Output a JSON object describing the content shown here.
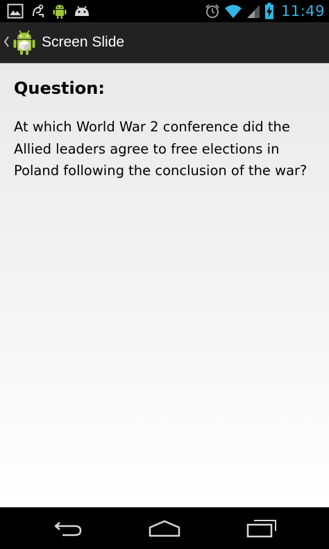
{
  "status_bar": {
    "time": "11:49",
    "left_icons": [
      "gallery-icon",
      "usb-debug-icon",
      "android-robot-icon",
      "android-head-icon"
    ],
    "right_icons": [
      "alarm-icon",
      "wifi-icon",
      "signal-icon",
      "battery-charging-icon"
    ],
    "time_color": "#33b5e5"
  },
  "action_bar": {
    "title": "Screen Slide",
    "up_icon": "chevron-left-icon",
    "app_icon": "android-app-icon",
    "background": "#222222"
  },
  "content": {
    "heading": "Question:",
    "question": "At which World War 2 conference did the Allied leaders agree to free elections in Poland following the conclusion of the war?"
  },
  "nav_bar": {
    "buttons": [
      "back-icon",
      "home-icon",
      "recent-apps-icon"
    ]
  }
}
